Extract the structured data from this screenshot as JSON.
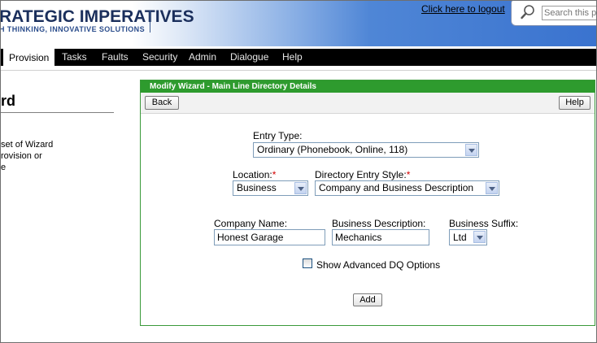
{
  "header": {
    "logo_title": "RATEGIC IMPERATIVES",
    "logo_tagline": "H THINKING, INNOVATIVE SOLUTIONS",
    "logout_link": "Click here to logout",
    "search_placeholder": "Search this por"
  },
  "nav": {
    "items": [
      {
        "label": "Provision",
        "active": true
      },
      {
        "label": "Tasks"
      },
      {
        "label": "Faults"
      },
      {
        "label": "Security"
      },
      {
        "label": "Admin"
      },
      {
        "label": "Dialogue"
      },
      {
        "label": "Help"
      }
    ]
  },
  "left": {
    "title": "rd",
    "text_lines": [
      "set of Wizard",
      "rovision or",
      "e"
    ]
  },
  "panel": {
    "title": "Modify Wizard - Main Line Directory Details",
    "back_label": "Back",
    "help_label": "Help",
    "entry_type_label": "Entry Type:",
    "entry_type_value": "Ordinary (Phonebook, Online, 118)",
    "location_label": "Location:",
    "location_value": "Business",
    "style_label": "Directory Entry Style:",
    "style_value": "Company and Business Description",
    "required_mark": "*",
    "company_name_label": "Company Name:",
    "company_name_value": "Honest Garage",
    "business_description_label": "Business Description:",
    "business_description_value": "Mechanics",
    "business_suffix_label": "Business Suffix:",
    "business_suffix_value": "Ltd",
    "advanced_checkbox_label": "Show Advanced DQ Options",
    "advanced_checked": false,
    "add_label": "Add"
  },
  "colors": {
    "panel_header": "#2e9b2e",
    "nav_bg": "#000000",
    "header_blue": "#3a73cf",
    "logo_text": "#1b2f5c",
    "required": "#d40000"
  }
}
